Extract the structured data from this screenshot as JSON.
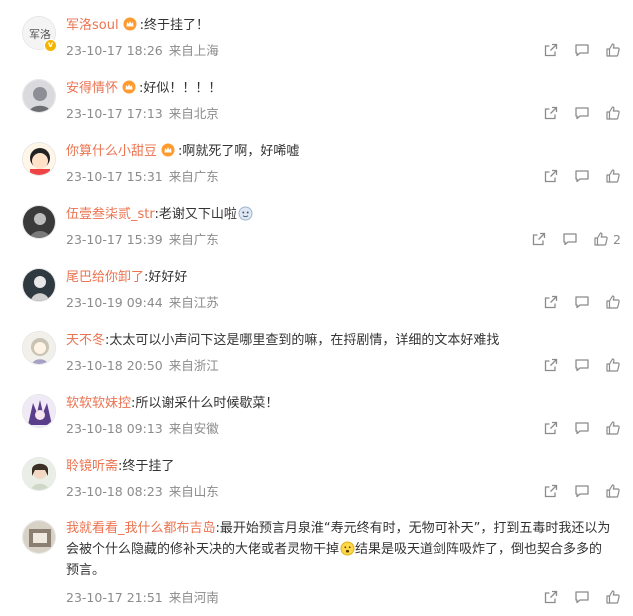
{
  "comments": [
    {
      "user": "军洛soul",
      "sep": ":",
      "text": "终于挂了！",
      "date": "23-10-17 18:26",
      "loc": "来自上海",
      "likes": "",
      "crown": true,
      "verified": true,
      "emoji": false
    },
    {
      "user": "安得情怀",
      "sep": ":",
      "text": "好似！！！！",
      "date": "23-10-17 17:13",
      "loc": "来自北京",
      "likes": "",
      "crown": true,
      "verified": false,
      "emoji": false
    },
    {
      "user": "你算什么小甜豆",
      "sep": ":",
      "text": "啊就死了啊，好唏嘘",
      "date": "23-10-17 15:31",
      "loc": "来自广东",
      "likes": "",
      "crown": true,
      "verified": false,
      "emoji": false
    },
    {
      "user": "伍壹叁柒贰_str",
      "sep": ":",
      "text": "老谢又下山啦",
      "date": "23-10-17 15:39",
      "loc": "来自广东",
      "likes": "2",
      "crown": false,
      "verified": false,
      "emoji": true
    },
    {
      "user": "尾巴给你卸了",
      "sep": ":",
      "text": "好好好",
      "date": "23-10-19 09:44",
      "loc": "来自江苏",
      "likes": "",
      "crown": false,
      "verified": false,
      "emoji": false
    },
    {
      "user": "天不冬",
      "sep": ":",
      "text": "太太可以小声问下这是哪里查到的嘛，在捋剧情，详细的文本好难找",
      "date": "23-10-18 20:50",
      "loc": "来自浙江",
      "likes": "",
      "crown": false,
      "verified": false,
      "emoji": false
    },
    {
      "user": "软软软妹控",
      "sep": ":",
      "text": "所以谢采什么时候歇菜！",
      "date": "23-10-18 09:13",
      "loc": "来自安徽",
      "likes": "",
      "crown": false,
      "verified": false,
      "emoji": false
    },
    {
      "user": "聆镜听斋",
      "sep": ":",
      "text": "终于挂了",
      "date": "23-10-18 08:23",
      "loc": "来自山东",
      "likes": "",
      "crown": false,
      "verified": false,
      "emoji": false
    },
    {
      "user": "我就看看_我什么都布吉岛",
      "sep": ":",
      "text": "最开始预言月泉淮“寿元终有时，无物可补天”，打到五毒时我还以为会被个什么隐藏的修补天决的大佬或者灵物干掉",
      "text2": "结果是吸天道剑阵吸炸了，倒也契合多多的预言。",
      "date": "23-10-17 21:51",
      "loc": "来自河南",
      "likes": "",
      "crown": false,
      "verified": false,
      "emoji": true
    }
  ],
  "colors": {
    "username": "#eb7350",
    "meta": "#8b8b8b",
    "text": "#333333"
  }
}
